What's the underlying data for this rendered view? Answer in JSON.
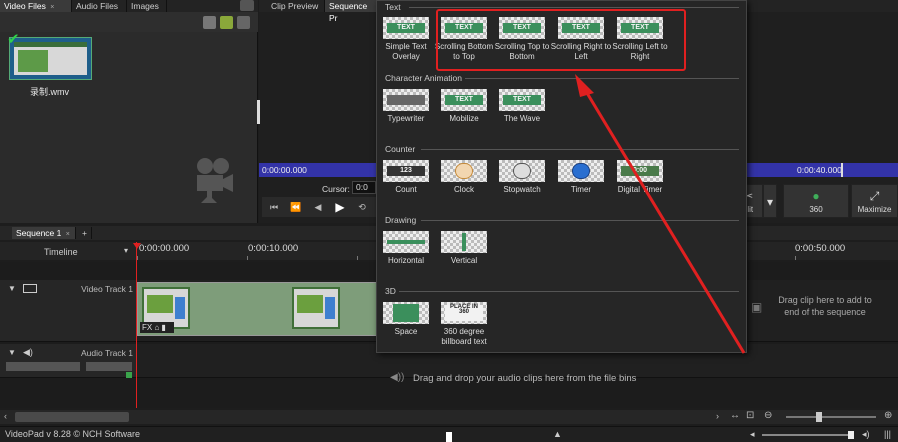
{
  "bins": {
    "tabs": [
      "Video Files",
      "Audio Files",
      "Images"
    ],
    "video_tab_close": "×",
    "clip_name": "录制.wmv"
  },
  "preview": {
    "tabs": [
      "Clip Preview",
      "Sequence Pr"
    ],
    "timecode_left": "0:00:00.000",
    "timecode_right": "0:00:40.000",
    "cursor_label": "Cursor:",
    "cursor_value": "0:0",
    "buttons": [
      {
        "label": "plit",
        "icon": "split-icon"
      },
      {
        "label": "360",
        "icon": "360-icon"
      },
      {
        "label": "Maximize",
        "icon": "maximize-icon"
      }
    ]
  },
  "timeline": {
    "sequence_tab": "Sequence 1",
    "sequence_close": "×",
    "add_tab": "+",
    "label": "Timeline",
    "ruler": [
      "0:00:00.000",
      "0:00:10.000",
      "0:00:50.000"
    ],
    "video_track": "Video Track 1",
    "audio_track": "Audio Track 1",
    "drag_note": "Drag clip here to add to end of the sequence",
    "audio_note": "Drag and drop your audio clips here from the file bins"
  },
  "status": {
    "app": "VideoPad v 8.28 © NCH Software"
  },
  "effects_menu": {
    "sections": [
      {
        "title": "Text",
        "items": [
          {
            "label": "Simple Text Overlay",
            "thumb": "TEXT"
          },
          {
            "label": "Scrolling Bottom to Top",
            "thumb": "TEXT"
          },
          {
            "label": "Scrolling Top to Bottom",
            "thumb": "TEXT"
          },
          {
            "label": "Scrolling Right to Left",
            "thumb": "TEXT"
          },
          {
            "label": "Scrolling Left to Right",
            "thumb": "TEXT"
          }
        ]
      },
      {
        "title": "Character Animation",
        "items": [
          {
            "label": "Typewriter",
            "thumb": ""
          },
          {
            "label": "Mobilize",
            "thumb": "TEXT"
          },
          {
            "label": "The Wave",
            "thumb": "TEXT"
          }
        ]
      },
      {
        "title": "Counter",
        "items": [
          {
            "label": "Count",
            "thumb": "123"
          },
          {
            "label": "Clock",
            "thumb": ""
          },
          {
            "label": "Stopwatch",
            "thumb": ""
          },
          {
            "label": "Timer",
            "thumb": ""
          },
          {
            "label": "Digital Timer",
            "thumb": "0:00"
          }
        ]
      },
      {
        "title": "Drawing",
        "items": [
          {
            "label": "Horizontal",
            "thumb": ""
          },
          {
            "label": "Vertical",
            "thumb": ""
          }
        ]
      },
      {
        "title": "3D",
        "items": [
          {
            "label": "Space",
            "thumb": ""
          },
          {
            "label": "360 degree billboard text",
            "thumb": "PLACE IN 360"
          }
        ]
      }
    ]
  },
  "colors": {
    "highlight": "#e02020",
    "accent_blue": "#3333a8",
    "thumb_green": "#3b8f5c"
  }
}
